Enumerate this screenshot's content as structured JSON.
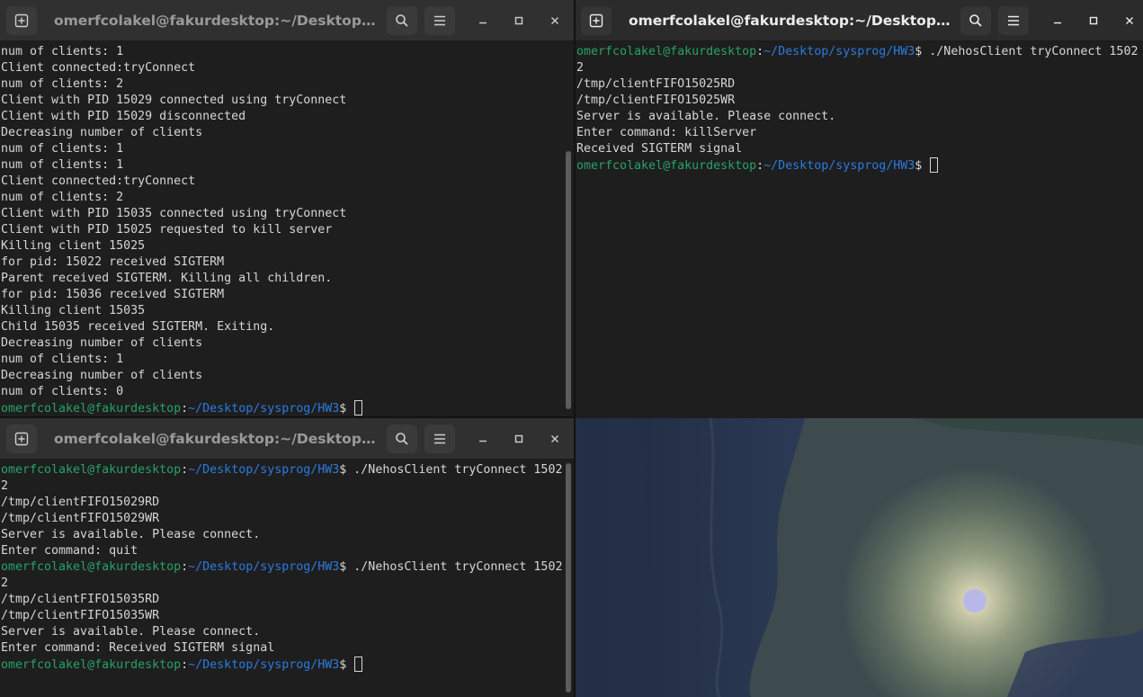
{
  "windows": [
    {
      "title": "omerfcolakel@fakurdesktop:~/Desktop/sysprog/...",
      "lines": [
        {
          "t": "num of clients: 1"
        },
        {
          "t": "Client connected:tryConnect"
        },
        {
          "t": "num of clients: 2"
        },
        {
          "t": "Client with PID 15029 connected using tryConnect"
        },
        {
          "t": "Client with PID 15029 disconnected"
        },
        {
          "t": "Decreasing number of clients"
        },
        {
          "t": "num of clients: 1"
        },
        {
          "t": "num of clients: 1"
        },
        {
          "t": "Client connected:tryConnect"
        },
        {
          "t": "num of clients: 2"
        },
        {
          "t": "Client with PID 15035 connected using tryConnect"
        },
        {
          "t": "Client with PID 15025 requested to kill server"
        },
        {
          "t": "Killing client 15025"
        },
        {
          "t": "for pid: 15022 received SIGTERM"
        },
        {
          "t": "Parent received SIGTERM. Killing all children."
        },
        {
          "t": "for pid: 15036 received SIGTERM"
        },
        {
          "t": "Killing client 15035"
        },
        {
          "t": "Child 15035 received SIGTERM. Exiting."
        },
        {
          "t": "Decreasing number of clients"
        },
        {
          "t": "num of clients: 1"
        },
        {
          "t": "Decreasing number of clients"
        },
        {
          "t": "num of clients: 0"
        },
        {
          "prompt": true,
          "user": "omerfcolakel@fakurdesktop",
          "sep": ":",
          "path": "~/Desktop/sysprog/HW3",
          "sym": "$ ",
          "cmd": "",
          "cursor": true
        }
      ]
    },
    {
      "title": "omerfcolakel@fakurdesktop:~/Desktop/sysprog/...",
      "lines": [
        {
          "prompt": true,
          "user": "omerfcolakel@fakurdesktop",
          "sep": ":",
          "path": "~/Desktop/sysprog/HW3",
          "sym": "$ ",
          "cmd": "./NehosClient tryConnect 1502"
        },
        {
          "t": "2"
        },
        {
          "t": "/tmp/clientFIFO15025RD"
        },
        {
          "t": "/tmp/clientFIFO15025WR"
        },
        {
          "t": "Server is available. Please connect."
        },
        {
          "t": "Enter command: killServer"
        },
        {
          "t": "Received SIGTERM signal"
        },
        {
          "prompt": true,
          "user": "omerfcolakel@fakurdesktop",
          "sep": ":",
          "path": "~/Desktop/sysprog/HW3",
          "sym": "$ ",
          "cmd": "",
          "cursor": true
        }
      ]
    },
    {
      "title": "omerfcolakel@fakurdesktop:~/Desktop/sysprog/...",
      "lines": [
        {
          "prompt": true,
          "user": "omerfcolakel@fakurdesktop",
          "sep": ":",
          "path": "~/Desktop/sysprog/HW3",
          "sym": "$ ",
          "cmd": "./NehosClient tryConnect 1502"
        },
        {
          "t": "2"
        },
        {
          "t": "/tmp/clientFIFO15029RD"
        },
        {
          "t": "/tmp/clientFIFO15029WR"
        },
        {
          "t": "Server is available. Please connect."
        },
        {
          "t": "Enter command: quit"
        },
        {
          "prompt": true,
          "user": "omerfcolakel@fakurdesktop",
          "sep": ":",
          "path": "~/Desktop/sysprog/HW3",
          "sym": "$ ",
          "cmd": "./NehosClient tryConnect 1502"
        },
        {
          "t": "2"
        },
        {
          "t": "/tmp/clientFIFO15035RD"
        },
        {
          "t": "/tmp/clientFIFO15035WR"
        },
        {
          "t": "Server is available. Please connect."
        },
        {
          "t": "Enter command: Received SIGTERM signal"
        },
        {
          "prompt": true,
          "user": "omerfcolakel@fakurdesktop",
          "sep": ":",
          "path": "~/Desktop/sysprog/HW3",
          "sym": "$ ",
          "cmd": "",
          "cursor": true
        }
      ]
    }
  ],
  "colors": {
    "prompt_user": "#26a269",
    "prompt_path": "#2a7bde",
    "terminal_bg": "#1e1e1e",
    "titlebar_bg": "#303030"
  },
  "icons": [
    "new-tab-icon",
    "search-icon",
    "menu-icon",
    "minimize-icon",
    "maximize-icon",
    "close-icon"
  ]
}
